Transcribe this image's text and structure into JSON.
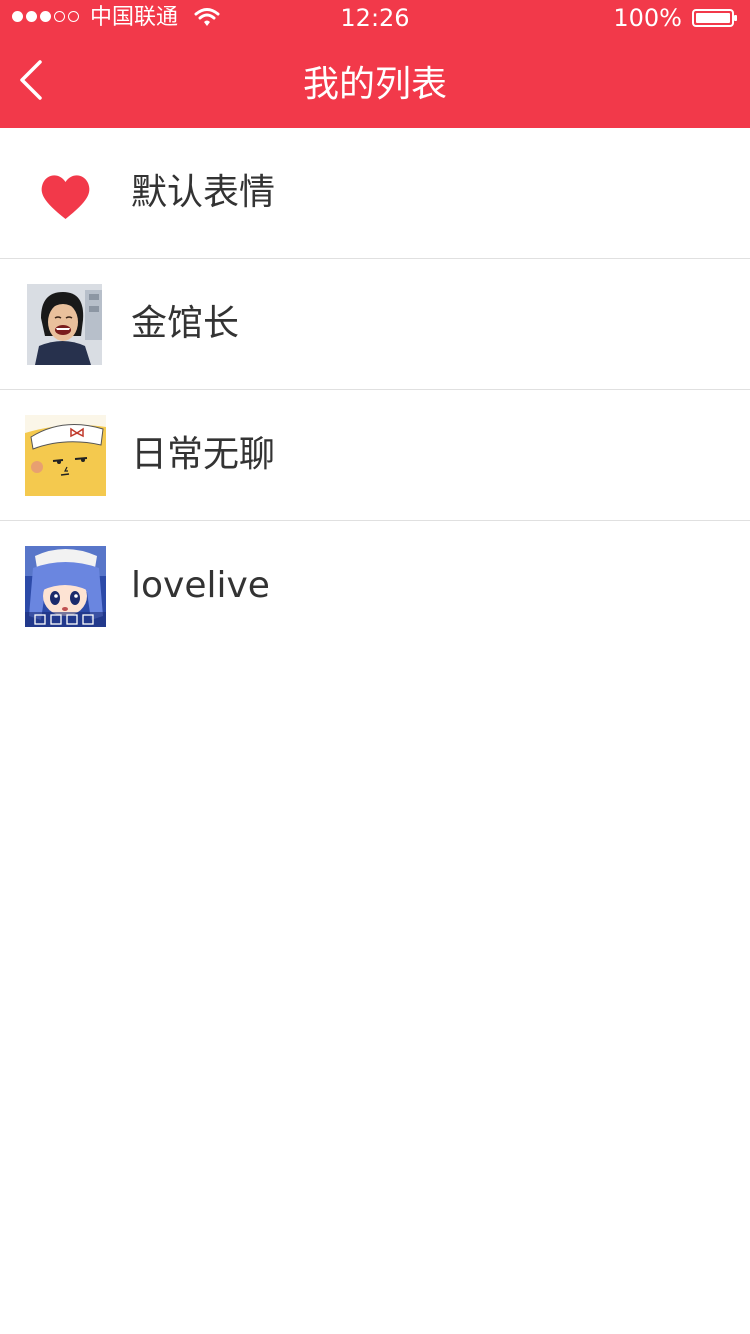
{
  "status_bar": {
    "carrier": "中国联通",
    "time": "12:26",
    "battery": "100%",
    "signal_strength": 3,
    "signal_max": 5
  },
  "nav": {
    "title": "我的列表",
    "back_icon": "chevron-left-icon"
  },
  "list": {
    "items": [
      {
        "label": "默认表情",
        "icon": "heart-icon"
      },
      {
        "label": "金馆长",
        "icon": "meme-photo-thumbnail"
      },
      {
        "label": "日常无聊",
        "icon": "cartoon-face-thumbnail"
      },
      {
        "label": "lovelive",
        "icon": "anime-girl-thumbnail"
      }
    ]
  },
  "colors": {
    "brand": "#f2394a",
    "text": "#333333",
    "divider": "#e0e0e0"
  }
}
